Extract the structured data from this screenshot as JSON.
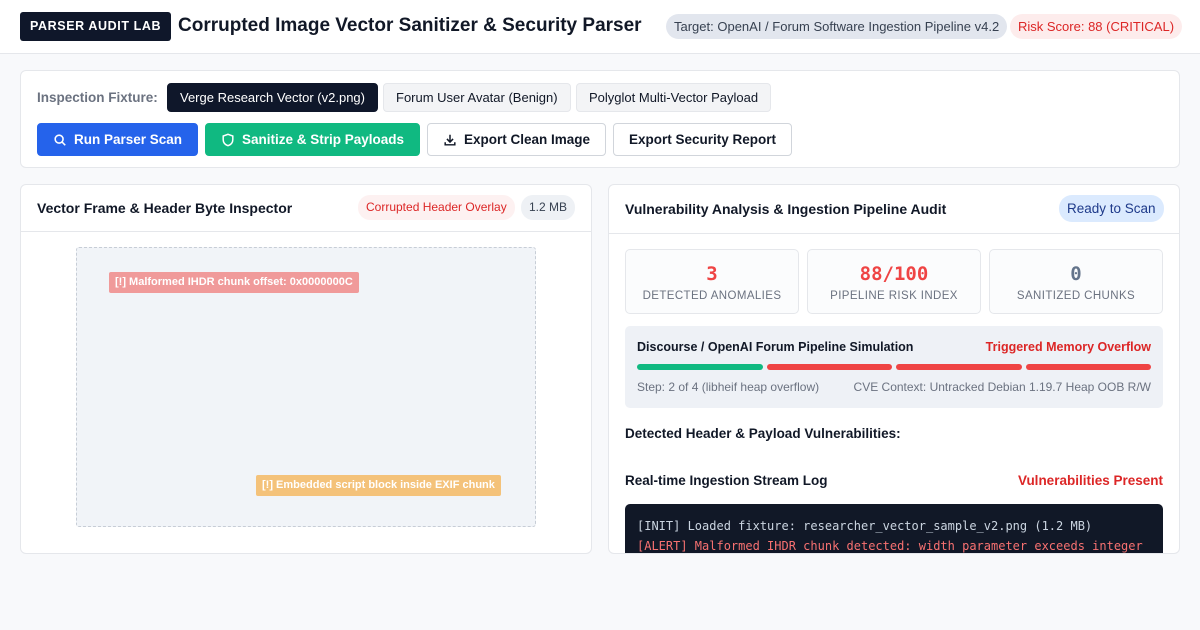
{
  "header": {
    "brand": "PARSER AUDIT LAB",
    "title": "Corrupted Image Vector Sanitizer & Security Parser",
    "target": "Target: OpenAI / Forum Software Ingestion Pipeline v4.2",
    "risk": "Risk Score: 88 (CRITICAL)"
  },
  "fixtures": {
    "label": "Inspection Fixture:",
    "options": [
      "Verge Research Vector (v2.png)",
      "Forum User Avatar (Benign)",
      "Polyglot Multi-Vector Payload"
    ],
    "selected_index": 0
  },
  "actions": {
    "run_scan": "Run Parser Scan",
    "sanitize": "Sanitize & Strip Payloads",
    "export_image": "Export Clean Image",
    "export_report": "Export Security Report"
  },
  "inspector": {
    "title": "Vector Frame & Header Byte Inspector",
    "overlay_tag": "Corrupted Header Overlay",
    "size_tag": "1.2 MB",
    "annotations": [
      "[!] Malformed IHDR chunk offset: 0x0000000C",
      "[!] Embedded script block inside EXIF chunk"
    ]
  },
  "audit": {
    "title": "Vulnerability Analysis & Ingestion Pipeline Audit",
    "status": "Ready to Scan",
    "metrics": [
      {
        "value": "3",
        "label": "DETECTED ANOMALIES",
        "color": "#ef4444"
      },
      {
        "value": "88/100",
        "label": "PIPELINE RISK INDEX",
        "color": "#ef4444"
      },
      {
        "value": "0",
        "label": "SANITIZED CHUNKS",
        "color": "#64748b"
      }
    ],
    "pipeline": {
      "title": "Discourse / OpenAI Forum Pipeline Simulation",
      "state": "Triggered Memory Overflow",
      "steps_total": 4,
      "segment_colors": [
        "#10b981",
        "#ef4444",
        "#ef4444",
        "#ef4444"
      ],
      "step_text": "Step: 2 of 4 (libheif heap overflow)",
      "cve_text": "CVE Context: Untracked Debian 1.19.7 Heap OOB R/W"
    },
    "vuln_heading": "Detected Header & Payload Vulnerabilities:",
    "log_heading": "Real-time Ingestion Stream Log",
    "log_flag": "Vulnerabilities Present",
    "log_lines": [
      {
        "level": "info",
        "text": "[INIT] Loaded fixture: researcher_vector_sample_v2.png (1.2 MB)"
      },
      {
        "level": "alert",
        "text": "[ALERT] Malformed IHDR chunk detected: width parameter exceeds integer"
      }
    ]
  },
  "colors": {
    "primary": "#2563eb",
    "success": "#10b981",
    "danger": "#dc2626",
    "dark": "#0f172a"
  }
}
